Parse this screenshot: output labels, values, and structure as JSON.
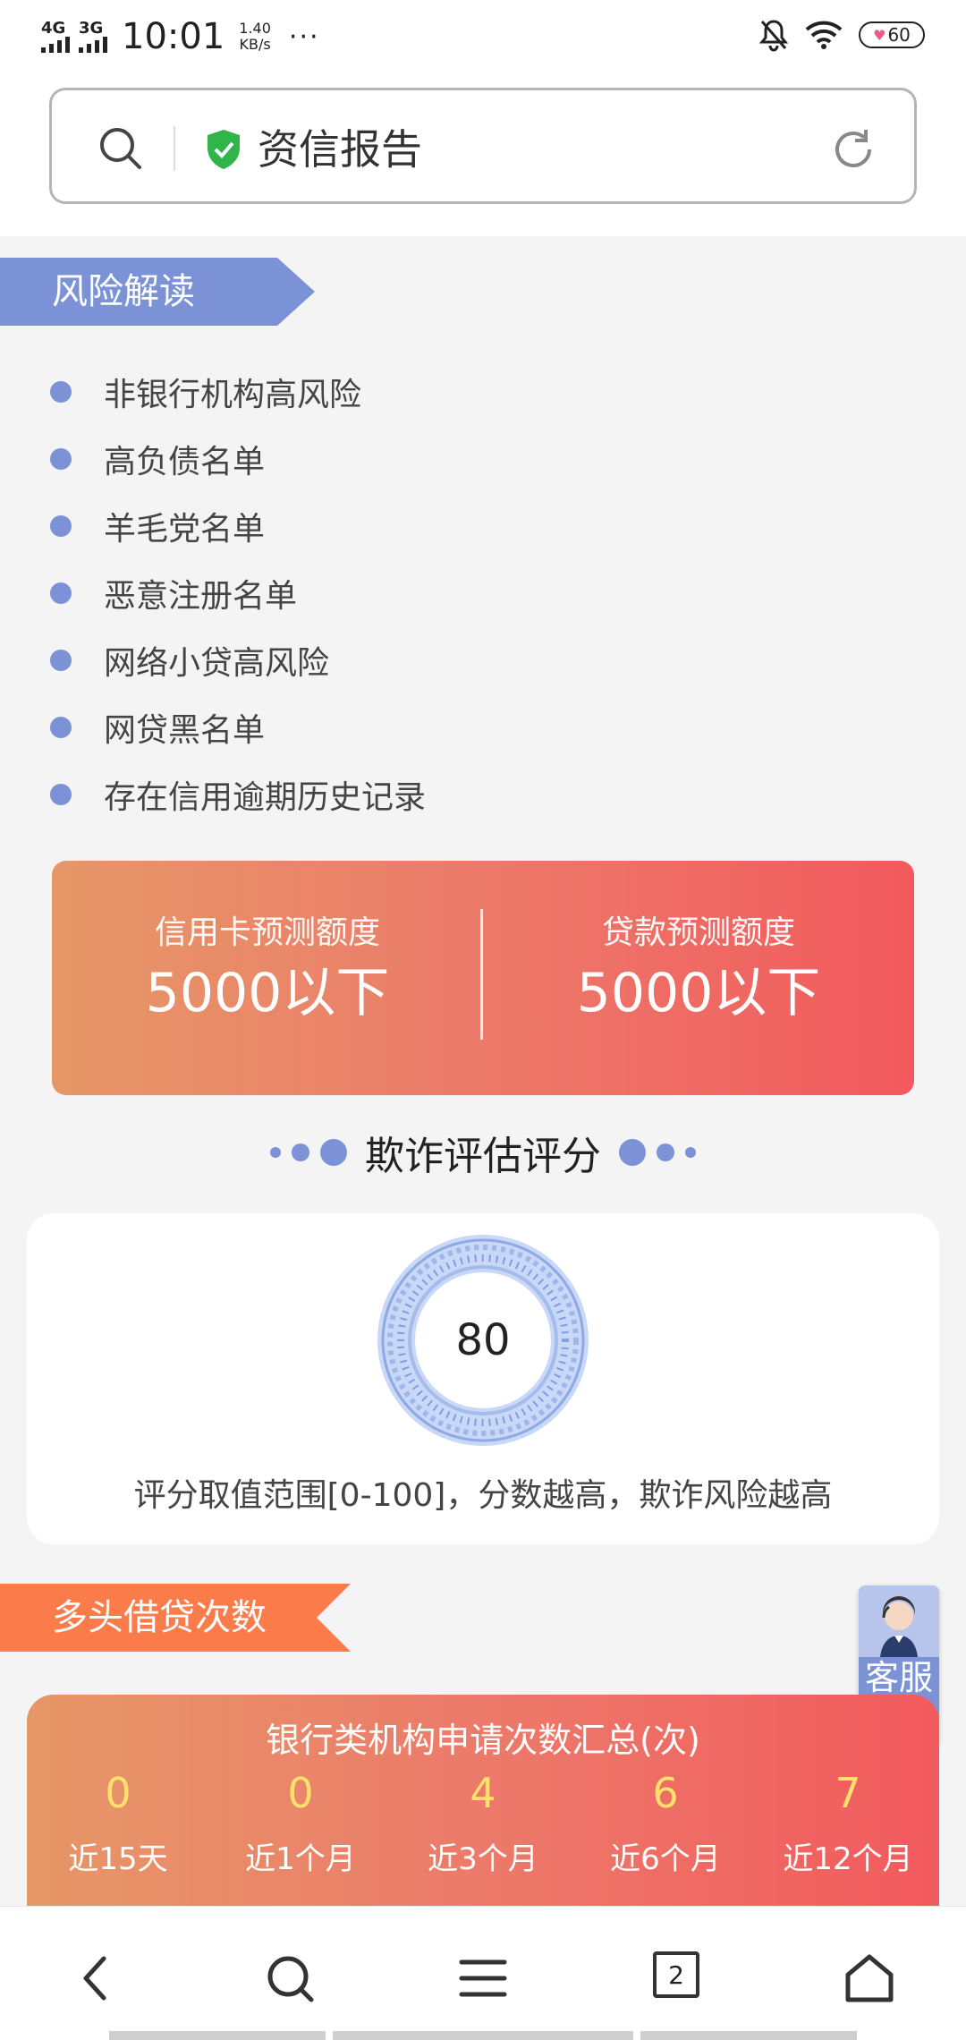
{
  "status_bar": {
    "network1": "4G",
    "network2": "3G",
    "time": "10:01",
    "speed_value": "1.40",
    "speed_unit": "KB/s",
    "more": "···",
    "battery": "60"
  },
  "search": {
    "title": "资信报告"
  },
  "risk_section": {
    "tag": "风险解读",
    "items": [
      "非银行机构高风险",
      "高负债名单",
      "羊毛党名单",
      "恶意注册名单",
      "网络小贷高风险",
      "网贷黑名单",
      "存在信用逾期历史记录"
    ]
  },
  "prediction": {
    "credit_label": "信用卡预测额度",
    "credit_value": "5000以下",
    "loan_label": "贷款预测额度",
    "loan_value": "5000以下"
  },
  "fraud": {
    "title": "欺诈评估评分",
    "score": "80",
    "note": "评分取值范围[0-100]，分数越高，欺诈风险越高"
  },
  "multi_loan": {
    "tag": "多头借贷次数",
    "bank_title": "银行类机构申请次数汇总(次)",
    "periods": [
      {
        "count": "0",
        "label": "近15天"
      },
      {
        "count": "0",
        "label": "近1个月"
      },
      {
        "count": "4",
        "label": "近3个月"
      },
      {
        "count": "6",
        "label": "近6个月"
      },
      {
        "count": "7",
        "label": "近12个月"
      }
    ]
  },
  "customer_service": {
    "label": "客服"
  },
  "nav": {
    "tab_count": "2"
  },
  "colors": {
    "accent_blue": "#7b93d6",
    "accent_orange": "#fc7b4a",
    "gradient_start": "#e69767",
    "gradient_end": "#f25a5d",
    "count_yellow": "#ffe16b"
  }
}
